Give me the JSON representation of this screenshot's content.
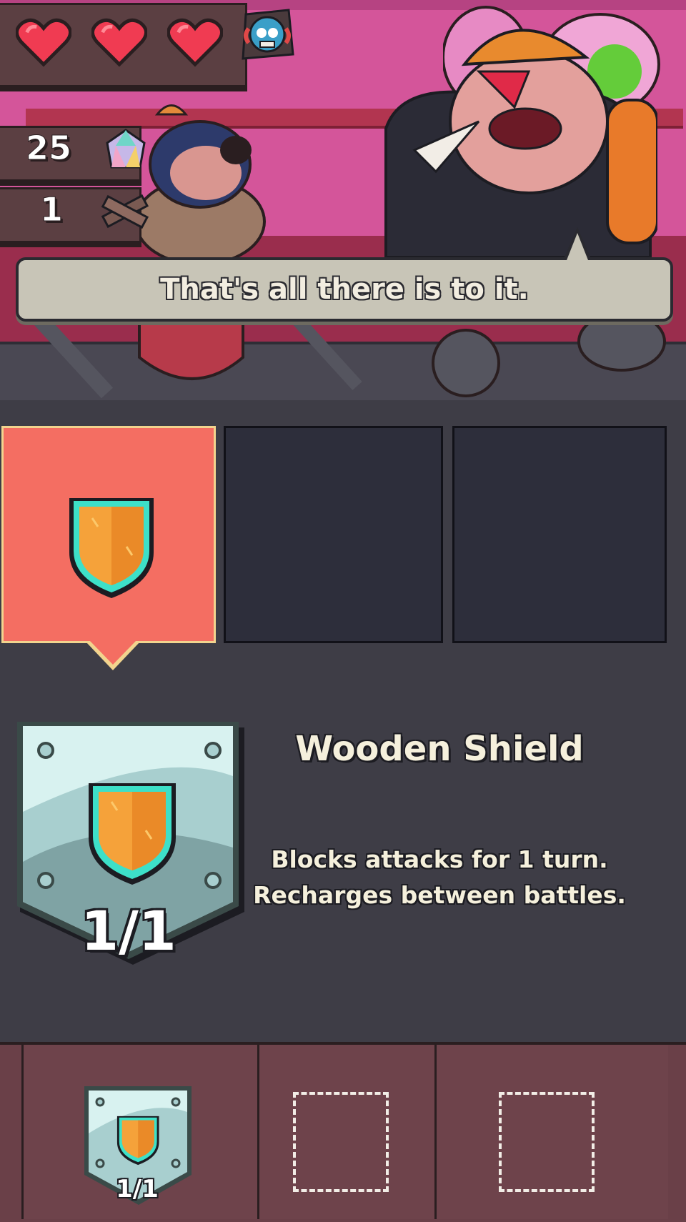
{
  "hud": {
    "hearts": [
      "heart",
      "heart",
      "heart"
    ],
    "gems": "25",
    "planks": "1",
    "icons": {
      "portrait": "fish-portrait-icon",
      "gem": "gem-icon",
      "plank": "crossed-planks-icon"
    }
  },
  "dialogue": {
    "text": "That's all there is to it."
  },
  "slots": [
    {
      "item": "wooden-shield",
      "selected": true
    },
    {
      "item": null,
      "selected": false
    },
    {
      "item": null,
      "selected": false
    }
  ],
  "detail": {
    "name": "Wooden Shield",
    "description_line1": "Blocks attacks for 1 turn.",
    "description_line2": "Recharges between battles.",
    "charges": "1/1"
  },
  "inventory": {
    "equipped_charges": "1/1",
    "empty_slots": 2
  },
  "colors": {
    "selected_slot": "#f46e62",
    "empty_slot": "#2d2e3b",
    "shield_orange": "#f5a23a",
    "shield_trim": "#3de0c8",
    "heart": "#f03b52"
  }
}
